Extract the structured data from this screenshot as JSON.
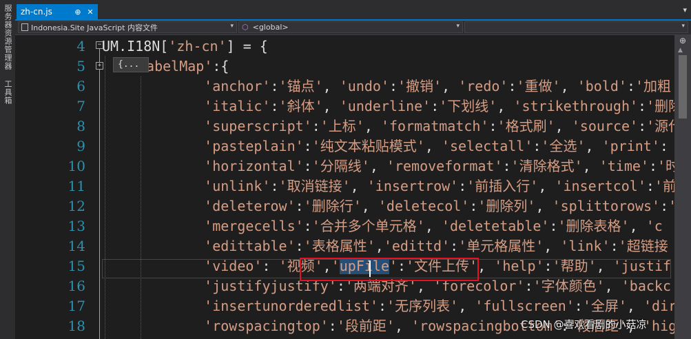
{
  "side_panel": {
    "server_explorer": "服务器资源管理器",
    "toolbox": "工具箱"
  },
  "tab": {
    "filename": "zh-cn.js",
    "pin_glyph": "⊕",
    "close_glyph": "✕",
    "dropdown_glyph": "▾"
  },
  "nav": {
    "project": "Indonesia.Site JavaScript 内容文件",
    "scope": "<global>",
    "arrow": "▾"
  },
  "editor": {
    "collapsed_label": "{...",
    "split_glyph": "⊕",
    "scroll_up_glyph": "▲",
    "line_numbers": [
      "4",
      "5",
      "6",
      "7",
      "8",
      "9",
      "10",
      "11",
      "12",
      "13",
      "14",
      "15",
      "16",
      "17",
      "18"
    ],
    "lines": [
      [
        [
          "i",
          "UM.I18N["
        ],
        [
          "s",
          "'zh-cn'"
        ],
        [
          "i",
          "] = {"
        ]
      ],
      [
        [
          "s",
          "labelMap'"
        ],
        [
          "i",
          ":{"
        ]
      ],
      [
        [
          "i",
          "    "
        ],
        [
          "s",
          "'anchor'"
        ],
        [
          "i",
          ":"
        ],
        [
          "s",
          "'锚点'"
        ],
        [
          "i",
          ", "
        ],
        [
          "s",
          "'undo'"
        ],
        [
          "i",
          ":"
        ],
        [
          "s",
          "'撤销'"
        ],
        [
          "i",
          ", "
        ],
        [
          "s",
          "'redo'"
        ],
        [
          "i",
          ":"
        ],
        [
          "s",
          "'重做'"
        ],
        [
          "i",
          ", "
        ],
        [
          "s",
          "'bold'"
        ],
        [
          "i",
          ":"
        ],
        [
          "s",
          "'加粗'"
        ]
      ],
      [
        [
          "i",
          "    "
        ],
        [
          "s",
          "'italic'"
        ],
        [
          "i",
          ":"
        ],
        [
          "s",
          "'斜体'"
        ],
        [
          "i",
          ", "
        ],
        [
          "s",
          "'underline'"
        ],
        [
          "i",
          ":"
        ],
        [
          "s",
          "'下划线'"
        ],
        [
          "i",
          ", "
        ],
        [
          "s",
          "'strikethrough'"
        ],
        [
          "i",
          ":"
        ],
        [
          "s",
          "'删除"
        ]
      ],
      [
        [
          "i",
          "    "
        ],
        [
          "s",
          "'superscript'"
        ],
        [
          "i",
          ":"
        ],
        [
          "s",
          "'上标'"
        ],
        [
          "i",
          ", "
        ],
        [
          "s",
          "'formatmatch'"
        ],
        [
          "i",
          ":"
        ],
        [
          "s",
          "'格式刷'"
        ],
        [
          "i",
          ", "
        ],
        [
          "s",
          "'source'"
        ],
        [
          "i",
          ":"
        ],
        [
          "s",
          "'源代"
        ]
      ],
      [
        [
          "i",
          "    "
        ],
        [
          "s",
          "'pasteplain'"
        ],
        [
          "i",
          ":"
        ],
        [
          "s",
          "'纯文本粘贴模式'"
        ],
        [
          "i",
          ", "
        ],
        [
          "s",
          "'selectall'"
        ],
        [
          "i",
          ":"
        ],
        [
          "s",
          "'全选'"
        ],
        [
          "i",
          ", "
        ],
        [
          "s",
          "'print'"
        ],
        [
          "i",
          ":"
        ]
      ],
      [
        [
          "i",
          "    "
        ],
        [
          "s",
          "'horizontal'"
        ],
        [
          "i",
          ":"
        ],
        [
          "s",
          "'分隔线'"
        ],
        [
          "i",
          ", "
        ],
        [
          "s",
          "'removeformat'"
        ],
        [
          "i",
          ":"
        ],
        [
          "s",
          "'清除格式'"
        ],
        [
          "i",
          ", "
        ],
        [
          "s",
          "'time'"
        ],
        [
          "i",
          ":"
        ],
        [
          "s",
          "'时"
        ]
      ],
      [
        [
          "i",
          "    "
        ],
        [
          "s",
          "'unlink'"
        ],
        [
          "i",
          ":"
        ],
        [
          "s",
          "'取消链接'"
        ],
        [
          "i",
          ", "
        ],
        [
          "s",
          "'insertrow'"
        ],
        [
          "i",
          ":"
        ],
        [
          "s",
          "'前插入行'"
        ],
        [
          "i",
          ", "
        ],
        [
          "s",
          "'insertcol'"
        ],
        [
          "i",
          ":"
        ],
        [
          "s",
          "'前"
        ]
      ],
      [
        [
          "i",
          "    "
        ],
        [
          "s",
          "'deleterow'"
        ],
        [
          "i",
          ":"
        ],
        [
          "s",
          "'删除行'"
        ],
        [
          "i",
          ", "
        ],
        [
          "s",
          "'deletecol'"
        ],
        [
          "i",
          ":"
        ],
        [
          "s",
          "'删除列'"
        ],
        [
          "i",
          ", "
        ],
        [
          "s",
          "'splittorows'"
        ],
        [
          "i",
          ":"
        ],
        [
          "s",
          "'"
        ]
      ],
      [
        [
          "i",
          "    "
        ],
        [
          "s",
          "'mergecells'"
        ],
        [
          "i",
          ":"
        ],
        [
          "s",
          "'合并多个单元格'"
        ],
        [
          "i",
          ", "
        ],
        [
          "s",
          "'deletetable'"
        ],
        [
          "i",
          ":"
        ],
        [
          "s",
          "'删除表格'"
        ],
        [
          "i",
          ", "
        ],
        [
          "s",
          "'c"
        ]
      ],
      [
        [
          "i",
          "    "
        ],
        [
          "s",
          "'edittable'"
        ],
        [
          "i",
          ":"
        ],
        [
          "s",
          "'表格属性'"
        ],
        [
          "i",
          ","
        ],
        [
          "s",
          "'edittd'"
        ],
        [
          "i",
          ":"
        ],
        [
          "s",
          "'单元格属性'"
        ],
        [
          "i",
          ", "
        ],
        [
          "s",
          "'link'"
        ],
        [
          "i",
          ":"
        ],
        [
          "s",
          "'超链接"
        ]
      ],
      [
        [
          "i",
          "    "
        ],
        [
          "s",
          "'video'"
        ],
        [
          "i",
          ": "
        ],
        [
          "s",
          "'视频'"
        ],
        [
          "i",
          ","
        ],
        [
          "s",
          "'"
        ],
        [
          "sel",
          "upFile"
        ],
        [
          "s",
          "'"
        ],
        [
          "i",
          ":"
        ],
        [
          "s",
          "'文件上传'"
        ],
        [
          "i",
          ", "
        ],
        [
          "s",
          "'help'"
        ],
        [
          "i",
          ":"
        ],
        [
          "s",
          "'帮助'"
        ],
        [
          "i",
          ", "
        ],
        [
          "s",
          "'justif"
        ]
      ],
      [
        [
          "i",
          "    "
        ],
        [
          "s",
          "'justifyjustify'"
        ],
        [
          "i",
          ":"
        ],
        [
          "s",
          "'两端对齐'"
        ],
        [
          "i",
          ", "
        ],
        [
          "s",
          "'forecolor'"
        ],
        [
          "i",
          ":"
        ],
        [
          "s",
          "'字体颜色'"
        ],
        [
          "i",
          ", "
        ],
        [
          "s",
          "'backc"
        ]
      ],
      [
        [
          "i",
          "    "
        ],
        [
          "s",
          "'insertunorderedlist'"
        ],
        [
          "i",
          ":"
        ],
        [
          "s",
          "'无序列表'"
        ],
        [
          "i",
          ", "
        ],
        [
          "s",
          "'fullscreen'"
        ],
        [
          "i",
          ":"
        ],
        [
          "s",
          "'全屏'"
        ],
        [
          "i",
          ", "
        ],
        [
          "s",
          "'dir"
        ]
      ],
      [
        [
          "i",
          "    "
        ],
        [
          "s",
          "'rowspacingtop'"
        ],
        [
          "i",
          ":"
        ],
        [
          "s",
          "'段前距'"
        ],
        [
          "i",
          ", "
        ],
        [
          "s",
          "'rowspacingbottom'"
        ],
        [
          "i",
          ":"
        ],
        [
          "s",
          "'段后距'"
        ],
        [
          "i",
          ", "
        ],
        [
          "s",
          "'high"
        ]
      ]
    ]
  },
  "watermark": "CSDN @喜欢看剧的小菇凉",
  "colors": {
    "accent": "#007acc",
    "string": "#d69d85",
    "line_number": "#2b91af",
    "highlight_box": "#e81123",
    "selection": "#264f78"
  }
}
